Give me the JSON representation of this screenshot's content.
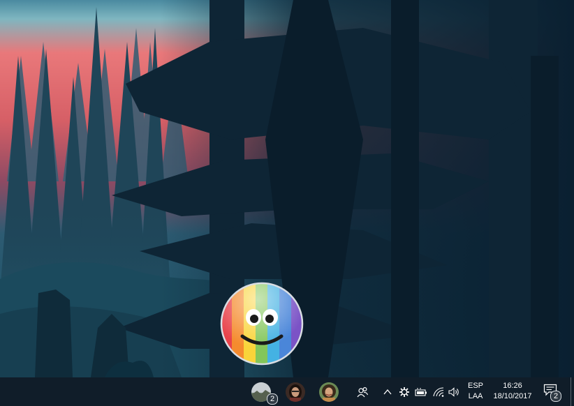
{
  "taskbar": {
    "people": {
      "group_badge": "2",
      "avatars": [
        {
          "name": "contact-group",
          "icon": "landscape-photo-icon"
        },
        {
          "name": "contact-woman-dark-hair",
          "icon": "woman-photo-icon"
        },
        {
          "name": "contact-woman-curly-hair",
          "icon": "woman-photo-icon"
        }
      ],
      "people_button_icon": "people-icon"
    },
    "tray": {
      "icons": [
        "chevron-up-icon",
        "gear-app-icon",
        "battery-icon",
        "wifi-icon",
        "volume-icon"
      ]
    },
    "language": {
      "line1": "ESP",
      "line2": "LAA"
    },
    "clock": {
      "time": "16:26",
      "date": "18/10/2017"
    },
    "action_center": {
      "badge": "2",
      "icon": "notification-icon"
    }
  },
  "desktop": {
    "pinned_contact": {
      "icon": "rainbow-smiley-emoji-icon"
    }
  },
  "colors": {
    "taskbar": "#101d29",
    "sky_sunset": "#e0666a",
    "forest_dark": "#0d2537",
    "forest_mid": "#1a4c62"
  }
}
